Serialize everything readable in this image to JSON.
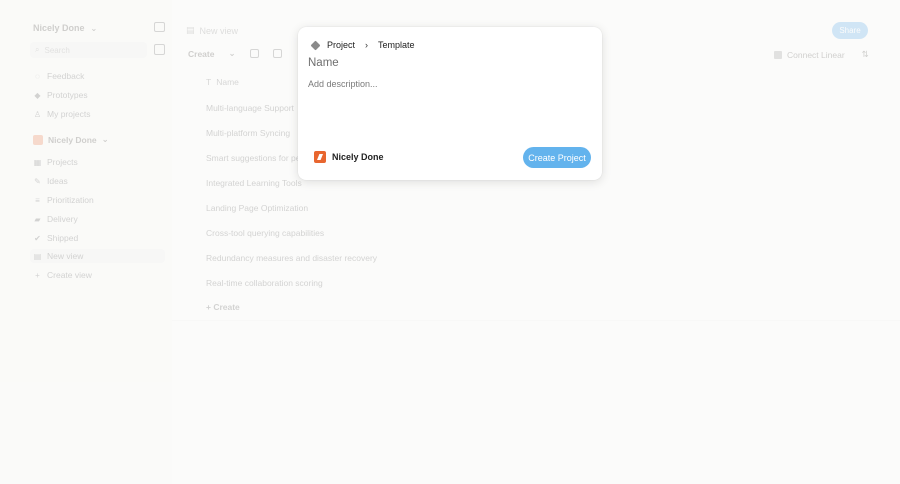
{
  "sidebar": {
    "workspace": "Nicely Done",
    "search_placeholder": "Search",
    "top_items": [
      {
        "label": "Feedback",
        "icon": "chat-icon"
      },
      {
        "label": "Prototypes",
        "icon": "diamond-icon"
      },
      {
        "label": "My projects",
        "icon": "person-icon"
      }
    ],
    "team": "Nicely Done",
    "team_items": [
      {
        "label": "Projects",
        "icon": "grid-icon"
      },
      {
        "label": "Ideas",
        "icon": "pencil-icon"
      },
      {
        "label": "Prioritization",
        "icon": "stack-icon"
      },
      {
        "label": "Delivery",
        "icon": "truck-icon"
      },
      {
        "label": "Shipped",
        "icon": "check-icon"
      },
      {
        "label": "New view",
        "icon": "calendar-icon"
      },
      {
        "label": "Create view",
        "icon": "plus-icon"
      }
    ]
  },
  "main": {
    "view_title": "New view",
    "share_label": "Share",
    "create_label": "Create",
    "connect_label": "Connect Linear",
    "column_name": "Name",
    "rows": [
      "Multi-language Support",
      "Multi-platform Syncing",
      "Smart suggestions for personalized",
      "Integrated Learning Tools",
      "Landing Page Optimization",
      "Cross-tool querying capabilities",
      "Redundancy measures and disaster recovery",
      "Real-time collaboration scoring"
    ],
    "add_row_label": "Create"
  },
  "modal": {
    "breadcrumb_type": "Project",
    "breadcrumb_template": "Template",
    "name_placeholder": "Name",
    "description_placeholder": "Add description...",
    "team_label": "Nicely Done",
    "submit_label": "Create Project"
  }
}
